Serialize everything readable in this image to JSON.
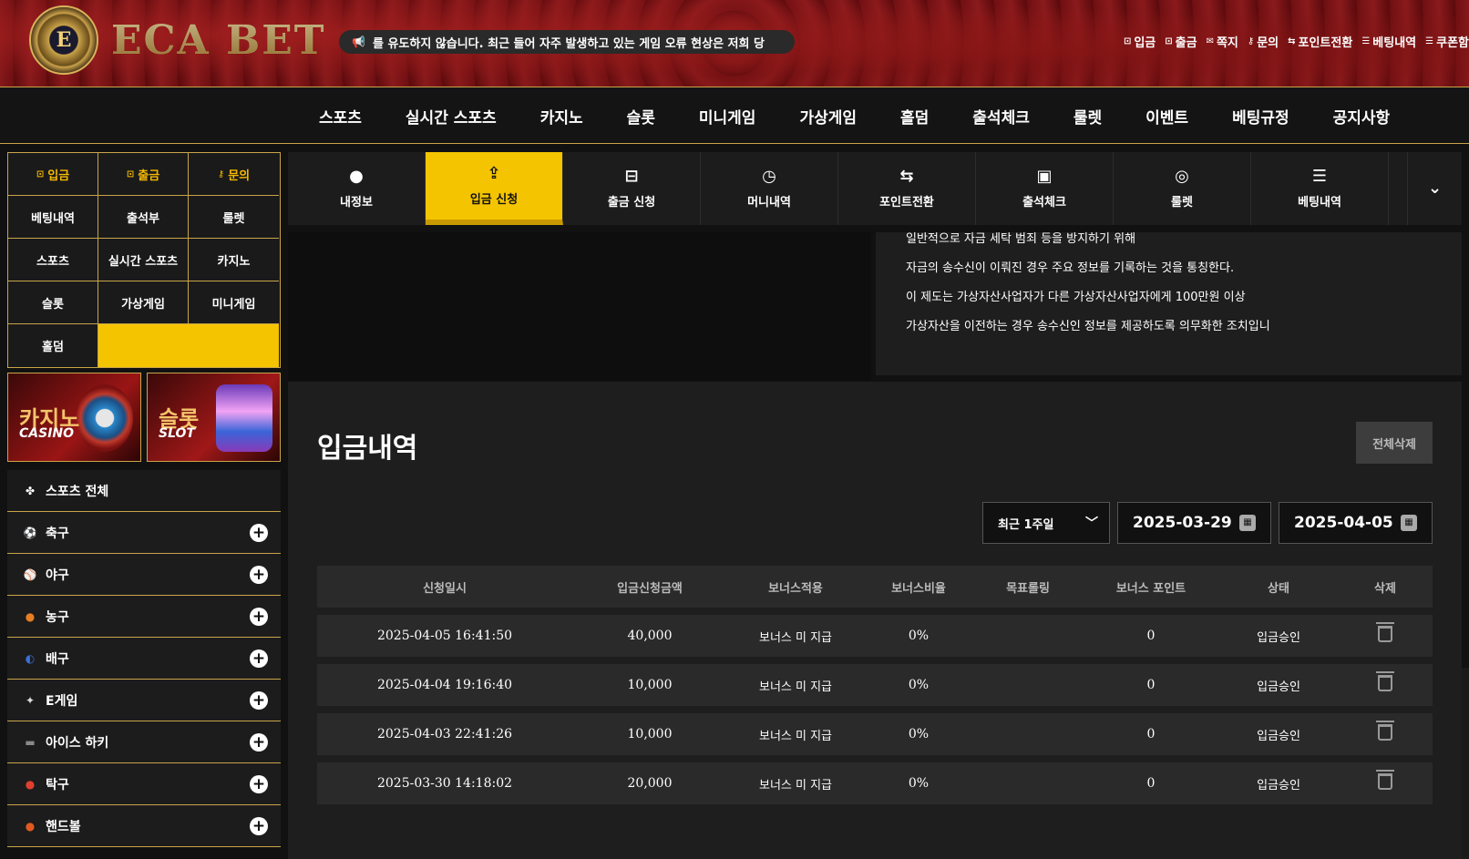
{
  "brand": {
    "name": "ECA BET",
    "emblem": "E"
  },
  "ticker": {
    "text": "를 유도하지 않습니다. 최근 들어 자주 발생하고 있는 게임 오류 현상은 저희 당"
  },
  "top_links": [
    {
      "icon": "deposit-icon",
      "glyph": "⊡",
      "label": "입금"
    },
    {
      "icon": "withdraw-icon",
      "glyph": "⊡",
      "label": "출금"
    },
    {
      "icon": "mail-icon",
      "glyph": "✉",
      "label": "쪽지"
    },
    {
      "icon": "key-icon",
      "glyph": "⚷",
      "label": "문의"
    },
    {
      "icon": "swap-icon",
      "glyph": "⇆",
      "label": "포인트전환"
    },
    {
      "icon": "list-icon",
      "glyph": "☰",
      "label": "베팅내역"
    },
    {
      "icon": "coupon-icon",
      "glyph": "☰",
      "label": "쿠폰함"
    }
  ],
  "main_nav": [
    "스포츠",
    "실시간 스포츠",
    "카지노",
    "슬롯",
    "미니게임",
    "가상게임",
    "홀덤",
    "출석체크",
    "룰렛",
    "이벤트",
    "베팅규정",
    "공지사항"
  ],
  "quick_grid": [
    {
      "label": "입금",
      "glyph": "⊡",
      "gold": true
    },
    {
      "label": "출금",
      "glyph": "⊡",
      "gold": true
    },
    {
      "label": "문의",
      "glyph": "⚷",
      "gold": true
    },
    {
      "label": "베팅내역"
    },
    {
      "label": "출석부"
    },
    {
      "label": "룰렛"
    },
    {
      "label": "스포츠"
    },
    {
      "label": "실시간 스포츠"
    },
    {
      "label": "카지노"
    },
    {
      "label": "슬롯"
    },
    {
      "label": "가상게임"
    },
    {
      "label": "미니게임"
    },
    {
      "label": "홀덤"
    }
  ],
  "banners": {
    "casino": {
      "title": "카지노",
      "subtitle": "CASINO"
    },
    "slot": {
      "title": "슬롯",
      "subtitle": "SLOT"
    }
  },
  "sports": {
    "header": "스포츠 전체",
    "items": [
      {
        "label": "축구",
        "icon": "soccer-ball-icon",
        "color": "#ffffff",
        "glyph": "⚽"
      },
      {
        "label": "야구",
        "icon": "baseball-icon",
        "color": "#ffffff",
        "glyph": "⚾"
      },
      {
        "label": "농구",
        "icon": "basketball-icon",
        "color": "#e67e22",
        "glyph": "●"
      },
      {
        "label": "배구",
        "icon": "volleyball-icon",
        "color": "#3b6fd8",
        "glyph": "◐"
      },
      {
        "label": "E게임",
        "icon": "egame-icon",
        "color": "#333333",
        "glyph": "✦"
      },
      {
        "label": "아이스 하키",
        "icon": "hockey-puck-icon",
        "color": "#444444",
        "glyph": "▬"
      },
      {
        "label": "탁구",
        "icon": "table-tennis-icon",
        "color": "#e04030",
        "glyph": "●"
      },
      {
        "label": "핸드볼",
        "icon": "handball-icon",
        "color": "#e05a20",
        "glyph": "●"
      }
    ]
  },
  "tabs": [
    {
      "label": "내정보",
      "icon": "user-icon",
      "glyph": "👤"
    },
    {
      "label": "입금 신청",
      "icon": "deposit-request-icon",
      "glyph": "⇪",
      "active": true
    },
    {
      "label": "출금 신청",
      "icon": "withdraw-request-icon",
      "glyph": "⊟"
    },
    {
      "label": "머니내역",
      "icon": "clock-icon",
      "glyph": "◷"
    },
    {
      "label": "포인트전환",
      "icon": "exchange-icon",
      "glyph": "⇆"
    },
    {
      "label": "출석체크",
      "icon": "calendar-star-icon",
      "glyph": "▣"
    },
    {
      "label": "룰렛",
      "icon": "roulette-icon",
      "glyph": "◎"
    },
    {
      "label": "베팅내역",
      "icon": "bet-list-icon",
      "glyph": "☰"
    }
  ],
  "info_lines": [
    "일반적으로 자금 세탁 범죄 등을 방지하기 위해",
    "자금의 송수신이 이뤄진 경우 주요 정보를 기록하는 것을 통칭한다.",
    "이 제도는 가상자산사업자가 다른 가상자산사업자에게 100만원 이상",
    "가상자산을 이전하는 경우 송수신인 정보를 제공하도록 의무화한 조치입니"
  ],
  "panel": {
    "title": "입금내역",
    "delete_all": "전체삭제",
    "period": "최근 1주일",
    "date_from": "2025-03-29",
    "date_to": "2025-04-05",
    "columns": [
      "신청일시",
      "입금신청금액",
      "보너스적용",
      "보너스비율",
      "목표롤링",
      "보너스 포인트",
      "상태",
      "삭제"
    ],
    "rows": [
      {
        "datetime": "2025-04-05 16:41:50",
        "amount": "40,000",
        "bonus": "보너스 미 지급",
        "ratio": "0%",
        "rolling": "",
        "points": "0",
        "status": "입금승인"
      },
      {
        "datetime": "2025-04-04 19:16:40",
        "amount": "10,000",
        "bonus": "보너스 미 지급",
        "ratio": "0%",
        "rolling": "",
        "points": "0",
        "status": "입금승인"
      },
      {
        "datetime": "2025-04-03 22:41:26",
        "amount": "10,000",
        "bonus": "보너스 미 지급",
        "ratio": "0%",
        "rolling": "",
        "points": "0",
        "status": "입금승인"
      },
      {
        "datetime": "2025-03-30 14:18:02",
        "amount": "20,000",
        "bonus": "보너스 미 지급",
        "ratio": "0%",
        "rolling": "",
        "points": "0",
        "status": "입금승인"
      }
    ]
  },
  "colors": {
    "accent": "#f5c400",
    "border_gold": "#c9a54a",
    "header_red": "#6e0f12"
  }
}
